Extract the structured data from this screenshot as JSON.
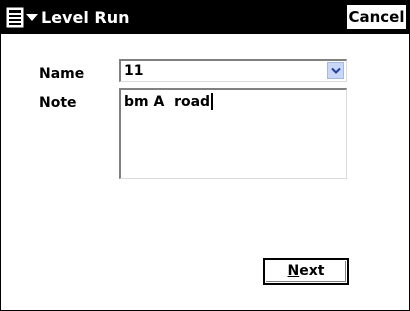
{
  "window": {
    "title": "Level Run",
    "cancel_label": "Cancel",
    "menu_icon": "start-menu-icon"
  },
  "form": {
    "name_label": "Name",
    "name_value": "11",
    "note_label": "Note",
    "note_value": "bm A  road"
  },
  "footer": {
    "next_mnemonic": "N",
    "next_rest": "ext"
  },
  "colors": {
    "titlebar": "#000000",
    "title_text": "#ffffff",
    "combo_arrow_bg": "#c9d8f7",
    "combo_arrow_glyph": "#1f3fa0"
  }
}
